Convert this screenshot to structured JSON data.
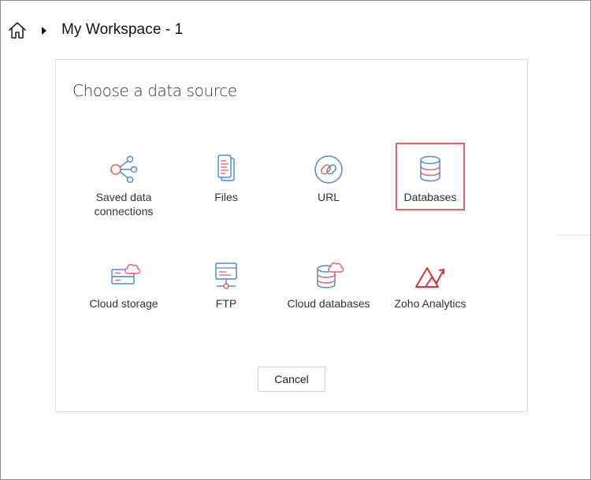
{
  "header": {
    "home_icon": "home-icon",
    "caret_icon": "caret-right-icon",
    "workspace_title": "My Workspace - 1"
  },
  "dialog": {
    "title": "Choose a data source",
    "sources": [
      {
        "label": "Saved data\nconnections",
        "icon": "share-nodes-icon",
        "selected": false
      },
      {
        "label": "Files",
        "icon": "files-icon",
        "selected": false
      },
      {
        "label": "URL",
        "icon": "link-icon",
        "selected": false
      },
      {
        "label": "Databases",
        "icon": "database-icon",
        "selected": true
      },
      {
        "label": "Cloud storage",
        "icon": "cloud-storage-icon",
        "selected": false
      },
      {
        "label": "FTP",
        "icon": "ftp-icon",
        "selected": false
      },
      {
        "label": "Cloud databases",
        "icon": "cloud-database-icon",
        "selected": false
      },
      {
        "label": "Zoho Analytics",
        "icon": "zoho-analytics-icon",
        "selected": false
      }
    ],
    "cancel_label": "Cancel"
  },
  "colors": {
    "icon_blue": "#4f8ccf",
    "icon_red": "#e86060",
    "selection_border": "#e86060",
    "zoho_red": "#d9323b"
  }
}
